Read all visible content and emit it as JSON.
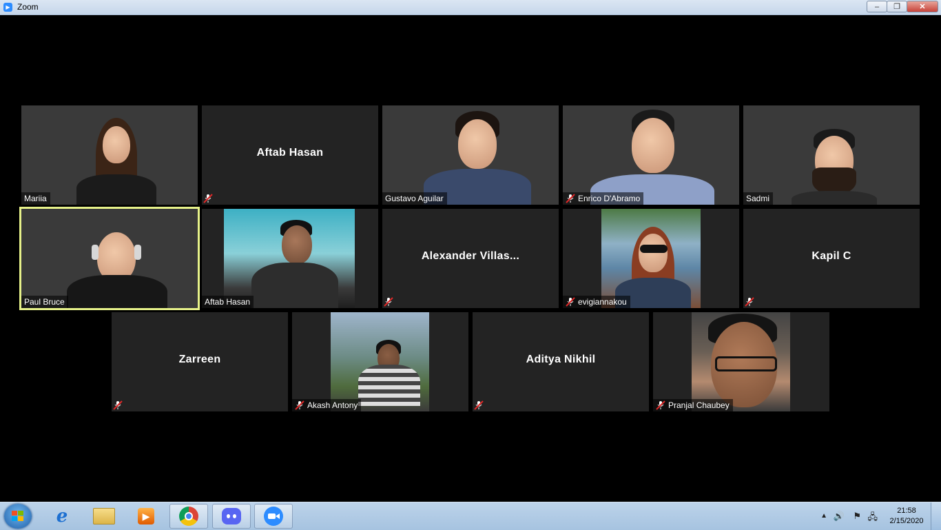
{
  "window": {
    "title": "Zoom",
    "controls": {
      "minimize": "–",
      "restore": "❐",
      "close": "✕"
    }
  },
  "participants": [
    {
      "name": "Mariia",
      "video": true,
      "muted": false
    },
    {
      "name": "Aftab Hasan",
      "video": false,
      "muted": true
    },
    {
      "name": "Gustavo Aguilar",
      "video": true,
      "muted": false
    },
    {
      "name": "Enrico D'Abramo",
      "video": true,
      "muted": true
    },
    {
      "name": "Sadmi",
      "video": true,
      "muted": false
    },
    {
      "name": "Paul Bruce",
      "video": true,
      "muted": false,
      "active_speaker": true
    },
    {
      "name": "Aftab Hasan",
      "video": true,
      "muted": false
    },
    {
      "name": "Alexander Villas...",
      "video": false,
      "muted": true
    },
    {
      "name": "evigiannakou",
      "video": true,
      "muted": true
    },
    {
      "name": "Kapil C",
      "video": false,
      "muted": true
    },
    {
      "name": "Zarreen",
      "video": false,
      "muted": true
    },
    {
      "name": "Akash Antony",
      "video": true,
      "muted": true
    },
    {
      "name": "Aditya Nikhil",
      "video": false,
      "muted": true
    },
    {
      "name": "Pranjal Chaubey",
      "video": true,
      "muted": true
    }
  ],
  "taskbar": {
    "pinned_apps": [
      {
        "name": "internet-explorer",
        "icon": "e"
      },
      {
        "name": "file-explorer",
        "icon": "folder"
      },
      {
        "name": "media-player",
        "icon": "play"
      },
      {
        "name": "chrome",
        "icon": "chrome"
      },
      {
        "name": "discord",
        "icon": "discord"
      },
      {
        "name": "zoom",
        "icon": "camera"
      }
    ],
    "clock": {
      "time": "21:58",
      "date": "2/15/2020"
    },
    "tray_icons": [
      "chevron-up-icon",
      "volume-icon",
      "flag-icon",
      "network-icon"
    ],
    "colors": {
      "zoom_blue": "#2d8cff",
      "active_speaker": "#e7f28a"
    }
  }
}
